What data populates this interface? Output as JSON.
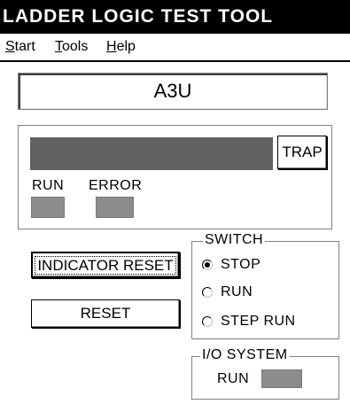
{
  "window": {
    "title": "LADDER LOGIC TEST TOOL"
  },
  "menu": {
    "items": [
      {
        "label": "Start",
        "accel": "S",
        "rest": "tart"
      },
      {
        "label": "Tools",
        "accel": "T",
        "rest": "ools"
      },
      {
        "label": "Help",
        "accel": "H",
        "rest": "elp"
      }
    ]
  },
  "model": {
    "value": "A3U"
  },
  "status": {
    "trap_label": "TRAP",
    "run_label": "RUN",
    "error_label": "ERROR"
  },
  "buttons": {
    "indicator_reset": "INDICATOR RESET",
    "reset": "RESET"
  },
  "switch": {
    "title": "SWITCH",
    "options": [
      "STOP",
      "RUN",
      "STEP RUN"
    ],
    "selected": "STOP"
  },
  "io_system": {
    "title": "I/O SYSTEM",
    "run_label": "RUN"
  },
  "colors": {
    "title_bar": "#000000",
    "lamp_off": "#8c8c8c",
    "background": "#ffffff"
  }
}
